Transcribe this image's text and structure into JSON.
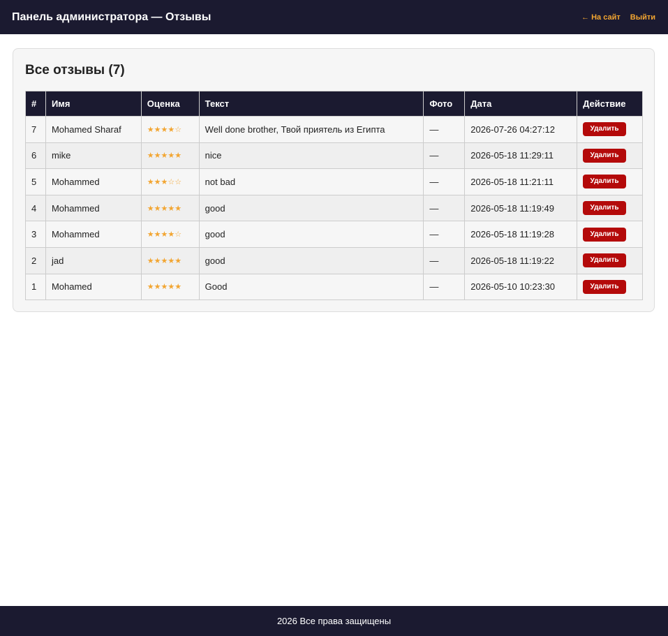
{
  "header": {
    "title": "Панель администратора — Отзывы",
    "links": {
      "site": "← На сайт",
      "logout": "Выйти"
    }
  },
  "main": {
    "title": "Все отзывы (7)",
    "table": {
      "headers": [
        "#",
        "Имя",
        "Оценка",
        "Текст",
        "Фото",
        "Дата",
        "Действие"
      ],
      "rows": [
        {
          "id": "7",
          "name": "Mohamed Sharaf",
          "rating": 4,
          "stars": "★★★★☆",
          "text": "Well done brother, Твой приятель из Египта",
          "photo": "—",
          "date": "2026-07-26 04:27:12",
          "action": "Удалить"
        },
        {
          "id": "6",
          "name": "mike",
          "rating": 5,
          "stars": "★★★★★",
          "text": "nice",
          "photo": "—",
          "date": "2026-05-18 11:29:11",
          "action": "Удалить"
        },
        {
          "id": "5",
          "name": "Mohammed",
          "rating": 3,
          "stars": "★★★☆☆",
          "text": "not bad",
          "photo": "—",
          "date": "2026-05-18 11:21:11",
          "action": "Удалить"
        },
        {
          "id": "4",
          "name": "Mohammed",
          "rating": 5,
          "stars": "★★★★★",
          "text": "good",
          "photo": "—",
          "date": "2026-05-18 11:19:49",
          "action": "Удалить"
        },
        {
          "id": "3",
          "name": "Mohammed",
          "rating": 4,
          "stars": "★★★★☆",
          "text": "good",
          "photo": "—",
          "date": "2026-05-18 11:19:28",
          "action": "Удалить"
        },
        {
          "id": "2",
          "name": "jad",
          "rating": 5,
          "stars": "★★★★★",
          "text": "good",
          "photo": "—",
          "date": "2026-05-18 11:19:22",
          "action": "Удалить"
        },
        {
          "id": "1",
          "name": "Mohamed",
          "rating": 5,
          "stars": "★★★★★",
          "text": "Good",
          "photo": "—",
          "date": "2026-05-10 10:23:30",
          "action": "Удалить"
        }
      ]
    }
  },
  "footer": {
    "text": "2026 Все права защищены"
  },
  "colors": {
    "header_bg": "#1b1a30",
    "accent": "#f2a531",
    "delete_button": "#b40a0a"
  }
}
